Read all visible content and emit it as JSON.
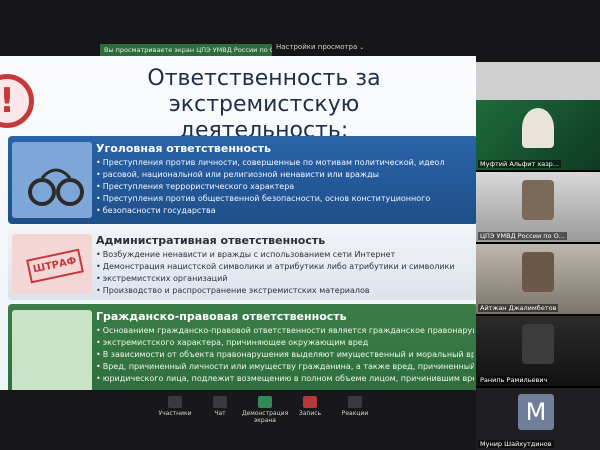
{
  "topbar": {
    "active_tab": "Вы просматриваете экран ЦПЭ УМВД России по Оренбургской",
    "view_settings": "Настройки просмотра",
    "chevron": "⌄"
  },
  "slide": {
    "warning_symbol": "!",
    "title_line1": "Ответственность за экстремистскую",
    "title_line2": "деятельность:",
    "sections": {
      "criminal": {
        "title": "Уголовная ответственность",
        "bullets": [
          "Преступления против личности, совершенные по мотивам политической, идеол",
          "расовой, национальной или религиозной ненависти или вражды",
          "Преступления террористического характера",
          "Преступления против общественной безопасности, основ конституционного",
          "безопасности государства"
        ]
      },
      "admin": {
        "title": "Административная ответственность",
        "stamp_text": "ШТРАФ",
        "bullets": [
          "Возбуждение ненависти и вражды с использованием сети Интернет",
          "Демонстрация нацистской символики и атрибутики либо атрибутики и символики",
          "экстремистских организаций",
          "Производство и распространение экстремистских материалов"
        ]
      },
      "civil": {
        "title": "Гражданско-правовая ответственность",
        "bullets": [
          "Основанием гражданско-правовой ответственности является гражданское правонарушен",
          "экстремистского характера, причиняющее окружающим вред",
          "В зависимости от объекта правонарушения выделяют имущественный и моральный вре",
          "Вред, причиненный личности или имуществу гражданина, а также вред, причиненный и",
          "юридического лица, подлежит возмещению в полном объеме лицом, причинившим вре"
        ]
      }
    }
  },
  "participants": [
    {
      "name": "Муфтий Альфит хазр..."
    },
    {
      "name": "ЦПЭ УМВД России по О..."
    },
    {
      "name": "Айтжан Джалимбетов"
    },
    {
      "name": "Ранипь Рамильевич"
    },
    {
      "name": "Мунир Шайхутдинов",
      "initial": "М"
    }
  ],
  "controls": {
    "participants": "Участники",
    "chat": "Чат",
    "share": "Демонстрация экрана",
    "record": "Запись",
    "reactions": "Реакции"
  },
  "colors": {
    "criminal_panel": "#2a63a8",
    "civil_panel": "#3b7d48",
    "active_tab": "#2e6c3b",
    "warning": "#c43a3a"
  },
  "icons": [
    "warning-icon",
    "handcuffs-icon",
    "fine-stamp-icon",
    "chevron-down-icon",
    "participants-icon",
    "chat-icon",
    "share-screen-icon",
    "record-icon",
    "reactions-icon"
  ]
}
